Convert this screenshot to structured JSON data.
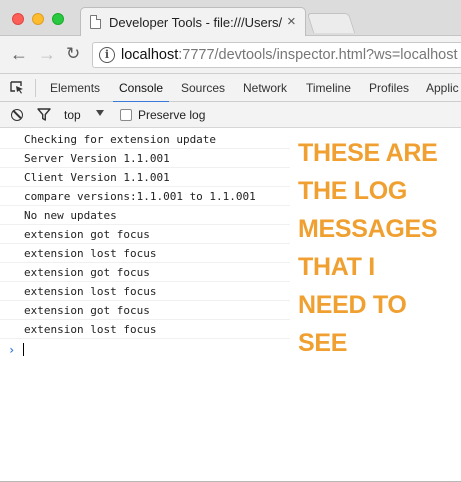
{
  "browser": {
    "tab_title": "Developer Tools - file:///Users/",
    "tab_close": "×",
    "address": {
      "host": "localhost",
      "rest": ":7777/devtools/inspector.html?ws=localhost"
    }
  },
  "devtools": {
    "tabs": [
      "Elements",
      "Console",
      "Sources",
      "Network",
      "Timeline",
      "Profiles",
      "Applic"
    ],
    "active_tab": "Console"
  },
  "console_toolbar": {
    "context": "top",
    "preserve_log_label": "Preserve log",
    "preserve_log_checked": false
  },
  "console": {
    "messages": [
      "Checking for extension update",
      "Server Version 1.1.001",
      "Client Version 1.1.001",
      "compare versions:1.1.001 to 1.1.001",
      "No new updates",
      "extension got focus",
      "extension lost focus",
      "extension got focus",
      "extension lost focus",
      "extension got focus",
      "extension lost focus"
    ],
    "prompt": "›"
  },
  "annotation": {
    "color": "#f0a030",
    "lines": [
      "THESE ARE",
      "THE LOG",
      "MESSAGES",
      "THAT I",
      "NEED TO",
      "SEE"
    ]
  },
  "icons": {
    "back": "arrow-left-icon",
    "forward": "arrow-right-icon",
    "reload": "reload-icon",
    "info": "info-icon",
    "inspect": "inspect-element-icon",
    "clear": "clear-console-icon",
    "filter": "filter-icon"
  }
}
